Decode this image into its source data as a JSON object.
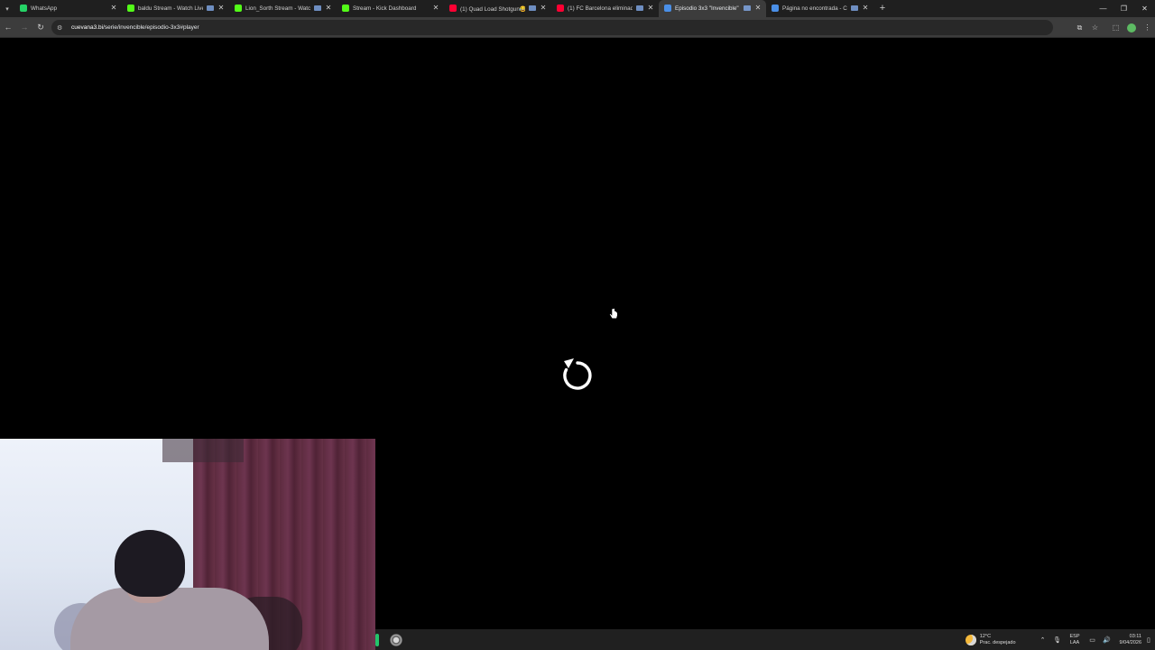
{
  "browser": {
    "tabs": [
      {
        "title": "WhatsApp",
        "favicon_color": "#25D366",
        "active": false,
        "badge": false
      },
      {
        "title": "baldu Stream - Watch Live",
        "favicon_color": "#53FC18",
        "active": false,
        "badge": true
      },
      {
        "title": "Lion_Sorth Stream - Watch Live",
        "favicon_color": "#53FC18",
        "active": false,
        "badge": true
      },
      {
        "title": "Stream - Kick Dashboard",
        "favicon_color": "#53FC18",
        "active": false,
        "badge": false
      },
      {
        "title": "(1) Quad Load Shotgun😂 (",
        "favicon_color": "#FF0033",
        "active": false,
        "badge": true
      },
      {
        "title": "(1) FC Barcelona eliminado",
        "favicon_color": "#FF0033",
        "active": false,
        "badge": true
      },
      {
        "title": "Episodio 3x3 \"Invencible\" - C",
        "favicon_color": "#4A8FE7",
        "active": true,
        "badge": true
      },
      {
        "title": "Página no encontrada - Cu",
        "favicon_color": "#4A8FE7",
        "active": false,
        "badge": true
      }
    ],
    "close_glyph": "✕",
    "new_tab_glyph": "+",
    "url_host": "cuevana3.bi",
    "url_path": "/serie/invencible/episodio-3x3#player"
  },
  "player": {
    "replay_icon": "replay-icon",
    "progress_percent": 100,
    "controls": [
      "gear-icon",
      "picture-in-picture-icon",
      "exit-fullscreen-icon"
    ]
  },
  "taskbar": {
    "weather_temp": "12°C",
    "weather_desc": "Prac. despejado",
    "lang_top": "ESP",
    "lang_bottom": "LAA",
    "time": "03:11",
    "date": "9/04/2026"
  },
  "colors": {
    "tabstrip_bg": "#1F1F1F",
    "toolbar_bg": "#3C3C3C",
    "player_bg": "#000000",
    "accent": "#8AB4F8"
  }
}
